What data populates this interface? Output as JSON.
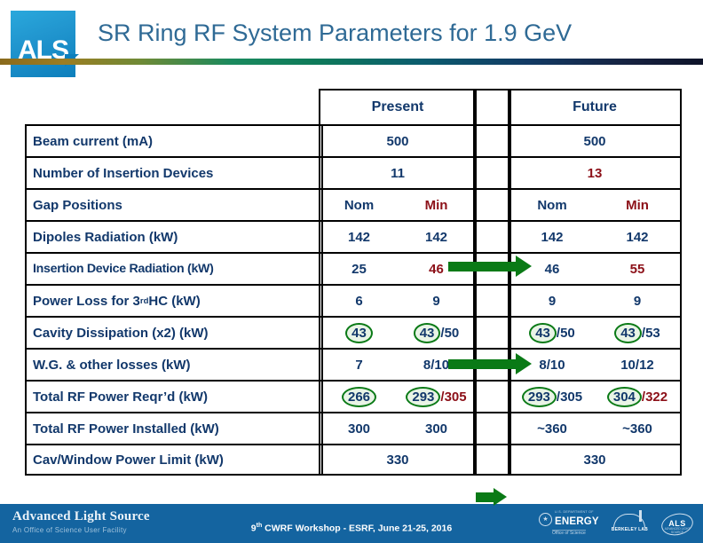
{
  "header": {
    "title": "SR Ring RF System Parameters for 1.9 GeV",
    "logo_text": "ALS",
    "title_color": "#2f6a95"
  },
  "table": {
    "column_groups": [
      {
        "label": "Present"
      },
      {
        "label": "Future"
      }
    ],
    "subheaders": {
      "nom": "Nom",
      "min": "Min"
    },
    "row_labels": [
      "Beam current (mA)",
      "Number of Insertion Devices",
      "Gap Positions",
      "Dipoles Radiation (kW)",
      "Insertion Device Radiation (kW)",
      "Power Loss for 3rd HC (kW)",
      "Cavity Dissipation (x2) (kW)",
      "W.G. & other losses (kW)",
      "Total RF Power Reqr’d (kW)",
      "Total RF Power Installed (kW)",
      "Cav/Window Power Limit (kW)"
    ],
    "rows": [
      {
        "label": "Beam current (mA)",
        "present_nom": "500",
        "present_min": "",
        "future_nom": "500",
        "future_min": "",
        "span": true
      },
      {
        "label": "Number of Insertion Devices",
        "present_nom": "11",
        "present_min": "",
        "future_nom": "13",
        "future_min": "",
        "span": true
      },
      {
        "label": "Gap Positions",
        "present_nom": "Nom",
        "present_min": "Min",
        "future_nom": "Nom",
        "future_min": "Min",
        "span": false
      },
      {
        "label": "Dipoles Radiation (kW)",
        "present_nom": "142",
        "present_min": "142",
        "future_nom": "142",
        "future_min": "142",
        "span": false
      },
      {
        "label": "Insertion Device Radiation (kW)",
        "present_nom": "25",
        "present_min": "46",
        "future_nom": "46",
        "future_min": "55",
        "span": false
      },
      {
        "label": "Power Loss for 3rd HC (kW)",
        "present_nom": "6",
        "present_min": "9",
        "future_nom": "9",
        "future_min": "9",
        "span": false
      },
      {
        "label": "Cavity Dissipation (x2) (kW)",
        "present_nom": "43",
        "present_min_a": "43",
        "present_min_b": "/50",
        "future_nom_a": "43",
        "future_nom_b": "/50",
        "future_min_a": "43",
        "future_min_b": "/53",
        "span": false
      },
      {
        "label": "W.G. & other losses (kW)",
        "present_nom": "7",
        "present_min": "8/10",
        "future_nom": "8/10",
        "future_min": "10/12",
        "span": false
      },
      {
        "label": "Total RF Power Reqr’d (kW)",
        "present_nom": "266",
        "present_min_a": "293",
        "present_min_b": "/305",
        "future_nom_a": "293",
        "future_nom_b": "/305",
        "future_min_a": "304",
        "future_min_b": "/322",
        "span": false
      },
      {
        "label": "Total RF Power Installed (kW)",
        "present_nom": "300",
        "present_min": "300",
        "future_nom": "~360",
        "future_min": "~360",
        "span": false
      },
      {
        "label": "Cav/Window Power Limit (kW)",
        "present_nom": "330",
        "present_min": "",
        "future_nom": "330",
        "future_min": "",
        "span": true
      }
    ],
    "label_superscript": {
      "base": "Power Loss for 3",
      "sup": "rd",
      "rest": " HC (kW)"
    },
    "colors": {
      "text_blue": "#12386b",
      "text_red": "#8c1018",
      "highlight_green": "#0a7a16",
      "arrow_green": "#0a7a16"
    }
  },
  "annotations": {
    "arrows": [
      {
        "name": "arrow-insertion-devices",
        "from_row": "Number of Insertion Devices"
      },
      {
        "name": "arrow-id-radiation",
        "from_row": "Insertion Device Radiation (kW)"
      },
      {
        "name": "arrow-total-rf-power",
        "from_row": "Total RF Power Reqr’d (kW)"
      }
    ],
    "circled_values": [
      "43",
      "43",
      "43",
      "43",
      "266",
      "293",
      "293",
      "304"
    ]
  },
  "footer": {
    "org_name": "Advanced Light Source",
    "org_sub": "An Office of Science User Facility",
    "center_text_pre": "9",
    "center_text_sup": "th",
    "center_text_post": " CWRF Workshop - ESRF, June 21-25, 2016",
    "doe_dept": "U.S. DEPARTMENT OF",
    "doe_word": "ENERGY",
    "doe_office": "Office of Science",
    "berkeley_lab": "BERKELEY LAB",
    "als_logo": "ALS",
    "als_logo_sub": "ADVANCED LIGHT SOURCE",
    "bar_color": "#1464a0"
  }
}
